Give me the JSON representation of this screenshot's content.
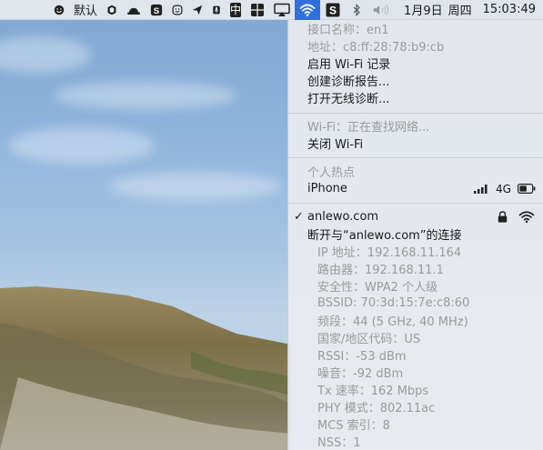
{
  "menubar": {
    "ime_label": "默认",
    "chinese_input_label": "中",
    "date": "1月9日",
    "weekday": "周四",
    "time": "15:03:49"
  },
  "wifi_menu": {
    "interface_name": "接口名称：en1",
    "address": "地址：c8:ff:28:78:b9:cb",
    "enable_logging": "启用 Wi-Fi 记录",
    "create_report": "创建诊断报告...",
    "open_diagnostics": "打开无线诊断...",
    "wifi_status": "Wi-Fi：正在查找网络...",
    "turn_off": "关闭 Wi-Fi",
    "hotspot_header": "个人热点",
    "hotspot_device": "iPhone",
    "hotspot_signal": "4G",
    "connected_network": "anlewo.com",
    "disconnect": "断开与“anlewo.com”的连接",
    "details": [
      "IP 地址：192.168.11.164",
      "路由器：192.168.11.1",
      "安全性：WPA2 个人级",
      "BSSID: 70:3d:15:7e:c8:60",
      "频段：44 (5 GHz, 40 MHz)",
      "国家/地区代码：US",
      "RSSI：-53 dBm",
      "噪音：-92 dBm",
      "Tx 速率：162 Mbps",
      "PHY 模式：802.11ac",
      "MCS 索引：8",
      "NSS：1"
    ]
  },
  "colors": {
    "accent": "#2f6fe0",
    "menu_bg": "#e8eaee",
    "disabled_text": "#9a9a9a"
  },
  "icons": [
    "smiley-icon",
    "shield-icon",
    "hat-icon",
    "s-app-icon",
    "face-icon",
    "send-icon",
    "mic-icon",
    "chinese-input-icon",
    "grid-icon",
    "airplay-icon",
    "wifi-icon",
    "s-square-icon",
    "bluetooth-icon",
    "volume-icon",
    "lock-icon",
    "signal-bars-icon",
    "battery-icon",
    "checkmark-icon"
  ]
}
